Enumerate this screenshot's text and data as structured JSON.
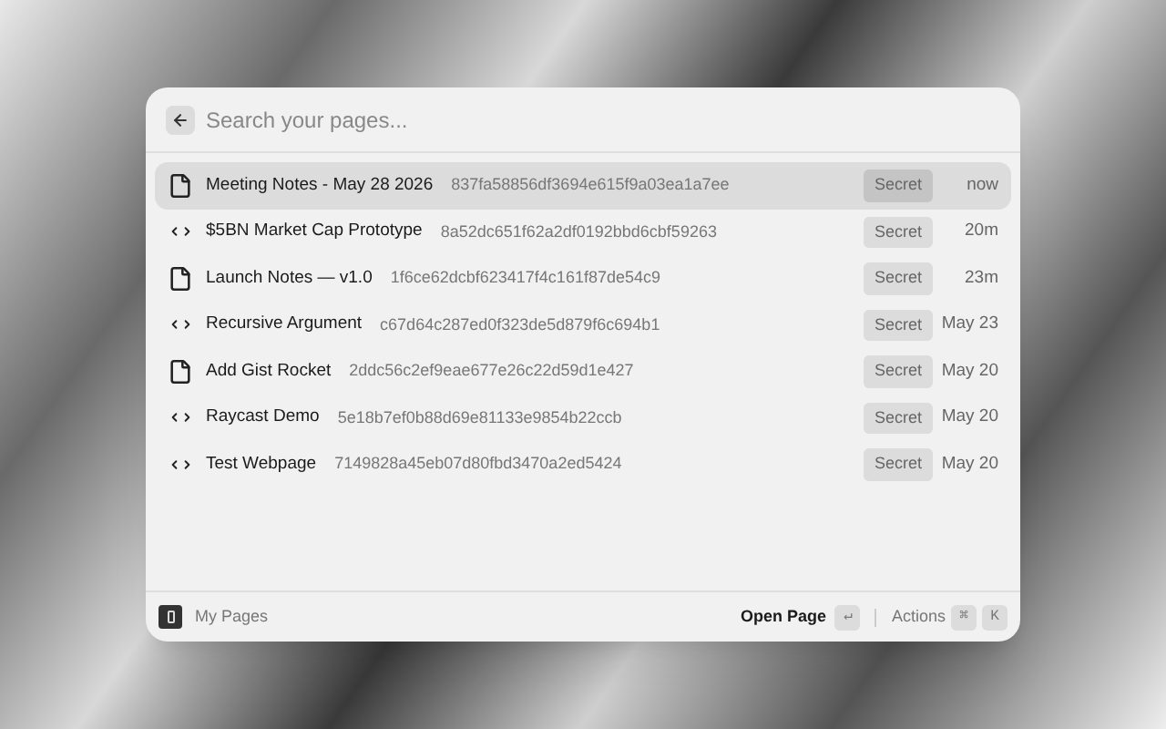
{
  "search": {
    "placeholder": "Search your pages..."
  },
  "items": [
    {
      "kind": "doc",
      "title": "Meeting Notes - May 28 2026",
      "id": "837fa58856df3694e615f9a03ea1a7ee",
      "tag": "Secret",
      "time": "now",
      "selected": true
    },
    {
      "kind": "code",
      "title": "$5BN Market Cap Prototype",
      "id": "8a52dc651f62a2df0192bbd6cbf59263",
      "tag": "Secret",
      "time": "20m",
      "selected": false
    },
    {
      "kind": "doc",
      "title": "Launch Notes — v1.0",
      "id": "1f6ce62dcbf623417f4c161f87de54c9",
      "tag": "Secret",
      "time": "23m",
      "selected": false
    },
    {
      "kind": "code",
      "title": "Recursive Argument",
      "id": "c67d64c287ed0f323de5d879f6c694b1",
      "tag": "Secret",
      "time": "May 23",
      "selected": false
    },
    {
      "kind": "doc",
      "title": "Add Gist Rocket",
      "id": "2ddc56c2ef9eae677e26c22d59d1e427",
      "tag": "Secret",
      "time": "May 20",
      "selected": false
    },
    {
      "kind": "code",
      "title": "Raycast Demo",
      "id": "5e18b7ef0b88d69e81133e9854b22ccb",
      "tag": "Secret",
      "time": "May 20",
      "selected": false
    },
    {
      "kind": "code",
      "title": "Test Webpage",
      "id": "7149828a45eb07d80fbd3470a2ed5424",
      "tag": "Secret",
      "time": "May 20",
      "selected": false
    }
  ],
  "footer": {
    "title": "My Pages",
    "primary_action": "Open Page",
    "primary_key": "↵",
    "actions_label": "Actions",
    "action_keys": [
      "⌘",
      "K"
    ]
  }
}
